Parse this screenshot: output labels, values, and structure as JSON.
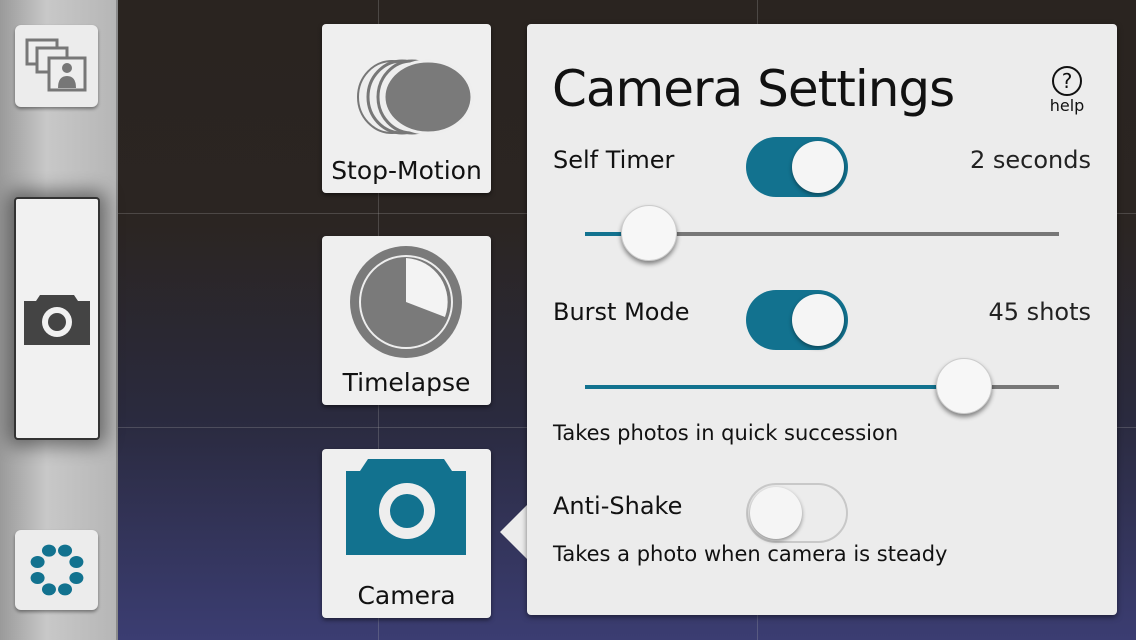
{
  "colors": {
    "accent": "#12728f",
    "icon_gray": "#7a7a7a",
    "panel": "#ececec"
  },
  "sidebar": {
    "gallery_icon": "gallery-icon",
    "shutter_icon": "camera-icon",
    "settings_icon": "dots-ring-icon"
  },
  "modes": [
    {
      "label": "Stop-Motion",
      "icon": "stacked-circles-icon"
    },
    {
      "label": "Timelapse",
      "icon": "clock-icon"
    },
    {
      "label": "Camera",
      "icon": "camera-icon",
      "selected": true
    }
  ],
  "settings": {
    "title": "Camera Settings",
    "help_label": "help",
    "help_icon": "question-circle-icon",
    "self_timer": {
      "label": "Self Timer",
      "enabled": true,
      "value": "2 seconds",
      "slider_fraction": 0.135
    },
    "burst_mode": {
      "label": "Burst Mode",
      "enabled": true,
      "value": "45 shots",
      "slider_fraction": 0.8,
      "description": "Takes photos in quick succession"
    },
    "anti_shake": {
      "label": "Anti-Shake",
      "enabled": false,
      "description": "Takes a photo when camera is steady"
    }
  }
}
